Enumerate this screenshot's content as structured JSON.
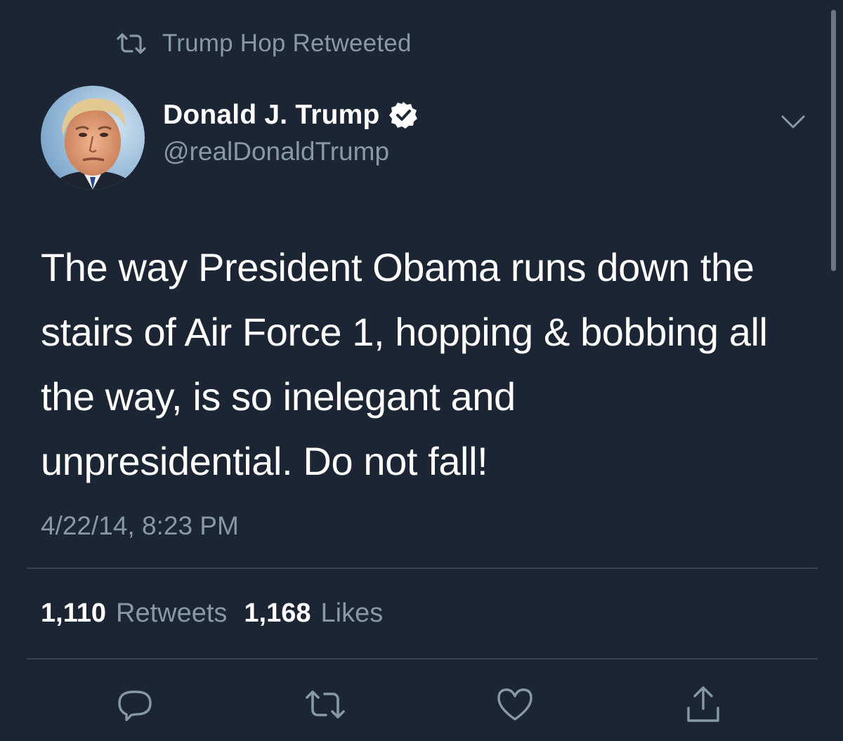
{
  "social_context": {
    "text": "Trump Hop Retweeted",
    "icon": "retweet-icon"
  },
  "author": {
    "name": "Donald J. Trump",
    "handle": "@realDonaldTrump",
    "verified": true,
    "avatar": "profile-photo"
  },
  "tweet": {
    "text": "The way President Obama runs down the\nstairs of Air Force 1, hopping & bobbing all\nthe way, is so inelegant and\nunpresidential. Do not fall!",
    "timestamp": "4/22/14, 8:23 PM"
  },
  "stats": {
    "retweets_count": "1,110",
    "retweets_label": "Retweets",
    "likes_count": "1,168",
    "likes_label": "Likes"
  },
  "actions": [
    {
      "name": "reply",
      "icon": "reply-icon"
    },
    {
      "name": "retweet",
      "icon": "retweet-icon"
    },
    {
      "name": "like",
      "icon": "heart-icon"
    },
    {
      "name": "share",
      "icon": "share-icon"
    }
  ],
  "colors": {
    "background": "#1b2533",
    "primary_text": "#ffffff",
    "secondary_text": "#8899a6",
    "divider": "#38444d"
  }
}
